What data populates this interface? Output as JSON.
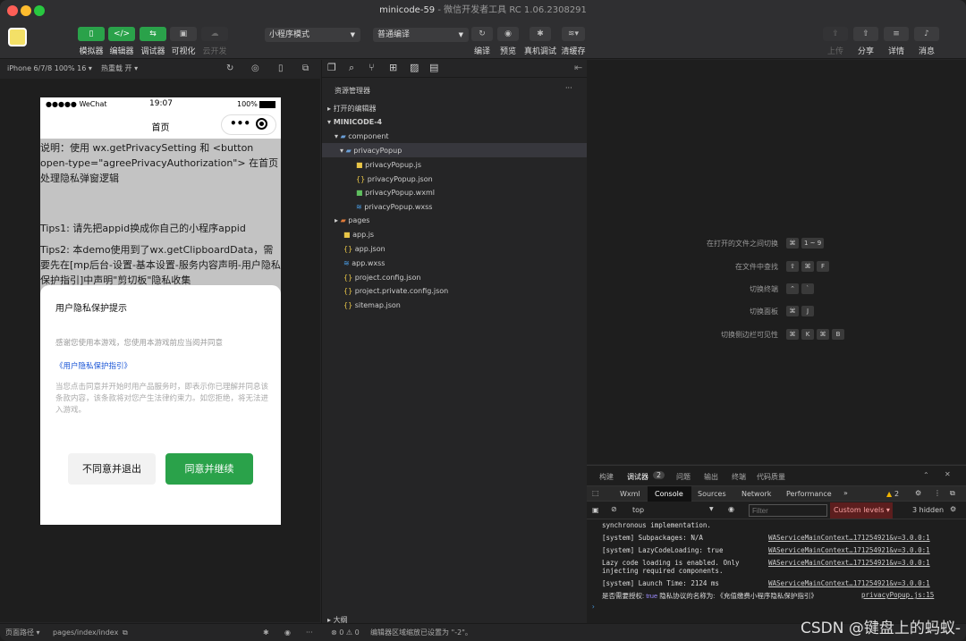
{
  "window": {
    "title": "minicode-59",
    "subtitle": " - 微信开发者工具 RC 1.06.2308291"
  },
  "toolbar": {
    "simulator": "模拟器",
    "editor": "编辑器",
    "debugger": "调试器",
    "visual": "可视化",
    "cloud": "云开发",
    "mode": "小程序模式",
    "compile_mode": "普通编译",
    "compile": "编译",
    "preview": "预览",
    "real_debug": "真机调试",
    "clear_cache": "清缓存",
    "upload": "上传",
    "share": "分享",
    "details": "详情",
    "messages": "消息"
  },
  "subbar": {
    "device": "iPhone 6/7/8 100% 16 ▾",
    "hotreload": "热重载 开 ▾"
  },
  "phone": {
    "carrier": "●●●●● WeChat",
    "time": "19:07",
    "battery": "100%",
    "page_title": "首页",
    "desc": "说明：使用 wx.getPrivacySetting 和 <button open-type=\"agreePrivacyAuthorization\"> 在首页处理隐私弹窗逻辑",
    "tips1": "Tips1: 请先把appid换成你自己的小程序appid",
    "tips2": "Tips2: 本demo使用到了wx.getClipboardData，需要先在[mp后台-设置-基本设置-服务内容声明-用户隐私保护指引]中声明\"剪切板\"隐私收集",
    "popup": {
      "title": "用户隐私保护提示",
      "intro": "感谢您使用本游戏，您使用本游戏前应当阅并同意",
      "link": "《用户隐私保护指引》",
      "body": "当您点击同意并开始时用产品服务时，即表示你已理解并同息该条款内容，该条款将对您产生法律约束力。如您拒绝，将无法进入游戏。",
      "refuse": "不同意并退出",
      "agree": "同意并继续"
    }
  },
  "explorer": {
    "title": "资源管理器",
    "open_editors": "打开的编辑器",
    "project": "MINICODE-4",
    "items": [
      "component",
      "privacyPopup",
      "privacyPopup.js",
      "privacyPopup.json",
      "privacyPopup.wxml",
      "privacyPopup.wxss",
      "pages",
      "app.js",
      "app.json",
      "app.wxss",
      "project.config.json",
      "project.private.config.json",
      "sitemap.json"
    ],
    "outline": "大纲"
  },
  "shortcuts": [
    {
      "label": "在打开的文件之间切换",
      "keys": [
        "⌘",
        "1 ~ 9"
      ]
    },
    {
      "label": "在文件中查找",
      "keys": [
        "⇧",
        "⌘",
        "F"
      ]
    },
    {
      "label": "切换终端",
      "keys": [
        "⌃",
        "`"
      ]
    },
    {
      "label": "切换面板",
      "keys": [
        "⌘",
        "J"
      ]
    },
    {
      "label": "切换侧边栏可见性",
      "keys": [
        "⌘",
        "K",
        "⌘",
        "B"
      ]
    }
  ],
  "debug": {
    "tabs": [
      "构建",
      "调试器",
      "问题",
      "输出",
      "终端",
      "代码质量"
    ],
    "debug_count": "2",
    "devtabs": [
      "Wxml",
      "Console",
      "Sources",
      "Network",
      "Performance",
      "»"
    ],
    "warn_count": "2",
    "context": "top",
    "filter_placeholder": "Filter",
    "levels": "Custom levels ▾",
    "hidden": "3 hidden",
    "logs": [
      {
        "text": "synchronous implementation.",
        "link": ""
      },
      {
        "text": "[system] Subpackages: N/A",
        "link": "WAServiceMainContext…171254921&v=3.0.0:1"
      },
      {
        "text": "[system] LazyCodeLoading: true",
        "link": "WAServiceMainContext…171254921&v=3.0.0:1"
      },
      {
        "text": "Lazy code loading is enabled. Only",
        "link": "WAServiceMainContext…171254921&v=3.0.0:1"
      },
      {
        "text": "injecting required components.",
        "link": ""
      },
      {
        "text": "[system] Launch Time: 2124 ms",
        "link": "WAServiceMainContext…171254921&v=3.0.0:1"
      }
    ],
    "last_log": {
      "a": "是否需要授权:",
      "b": "true",
      "c": "隐私协议的名称为:",
      "d": "《充值缴费小程序隐私保护指引》",
      "link": "privacyPopup.js:15"
    }
  },
  "status": {
    "path_label": "页面路径 ▾",
    "path": "pages/index/index",
    "errors": "⊗ 0 ⚠ 0",
    "note": "编辑器区域缩放已设置为 \"-2\"。"
  },
  "watermark": "CSDN @键盘上的蚂蚁-"
}
